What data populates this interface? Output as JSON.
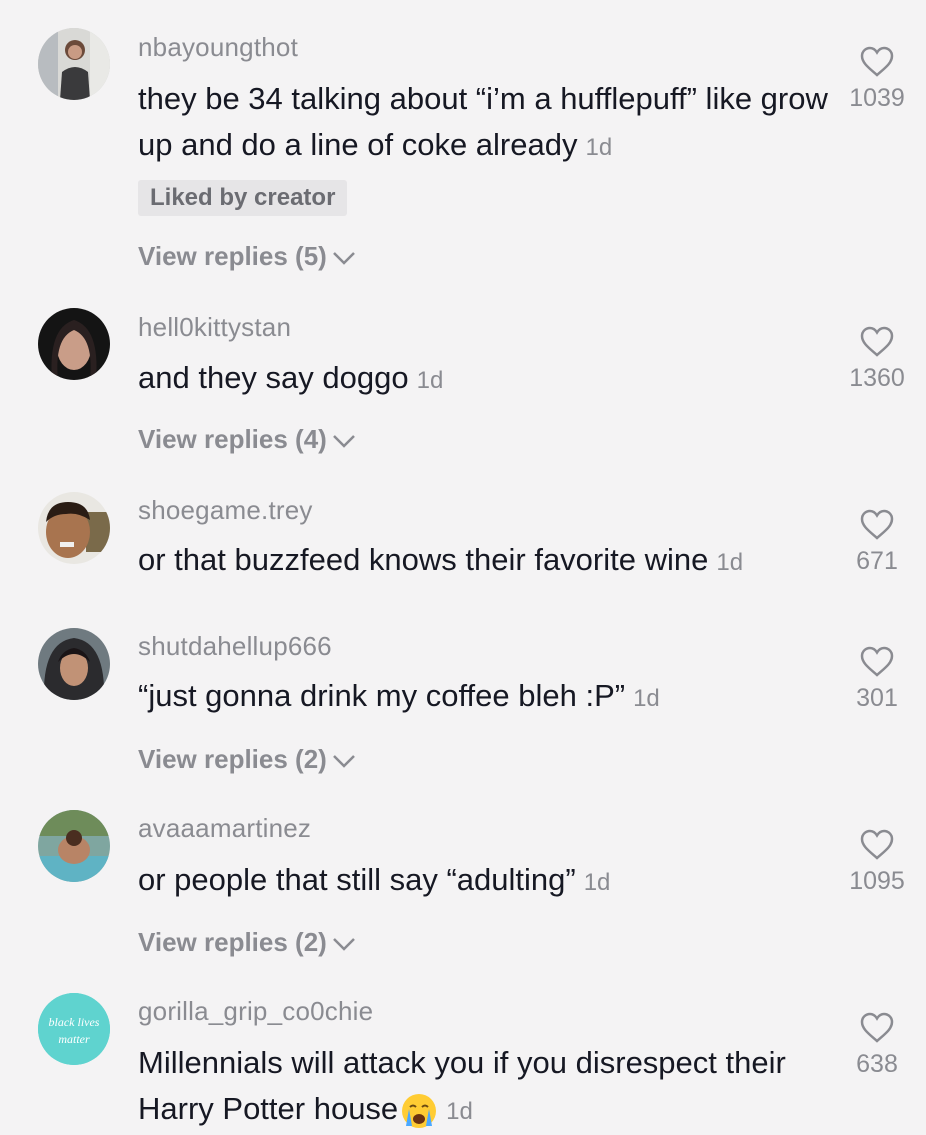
{
  "comments": [
    {
      "username": "nbayoungthot",
      "text": "they be 34 talking about “i’m a hufflepuff” like grow up and do a line of coke already",
      "time": "1d",
      "badge": "Liked by creator",
      "replies": "View replies (5)",
      "likes": "1039",
      "avatar": "woman-photo-avatar"
    },
    {
      "username": "hell0kittystan",
      "text": "and they say doggo",
      "time": "1d",
      "replies": "View replies (4)",
      "likes": "1360",
      "avatar": "girl-dark-hair-avatar"
    },
    {
      "username": "shoegame.trey",
      "text": "or that buzzfeed knows their favorite wine",
      "time": "1d",
      "likes": "671",
      "avatar": "boy-face-avatar"
    },
    {
      "username": "shutdahellup666",
      "text": "“just gonna drink my coffee bleh :P”",
      "time": "1d",
      "replies": "View replies (2)",
      "likes": "301",
      "avatar": "girl-hood-avatar"
    },
    {
      "username": "avaaamartinez",
      "text": "or people that still say “adulting”",
      "time": "1d",
      "replies": "View replies (2)",
      "likes": "1095",
      "avatar": "pool-photo-avatar"
    },
    {
      "username": "gorilla_grip_co0chie",
      "text": "Millennials will attack you if you disrespect their Harry Potter house",
      "time": "1d",
      "likes": "638",
      "avatar": "black-lives-matter-avatar",
      "avatar_text_1": "black lives",
      "avatar_text_2": "matter"
    }
  ]
}
